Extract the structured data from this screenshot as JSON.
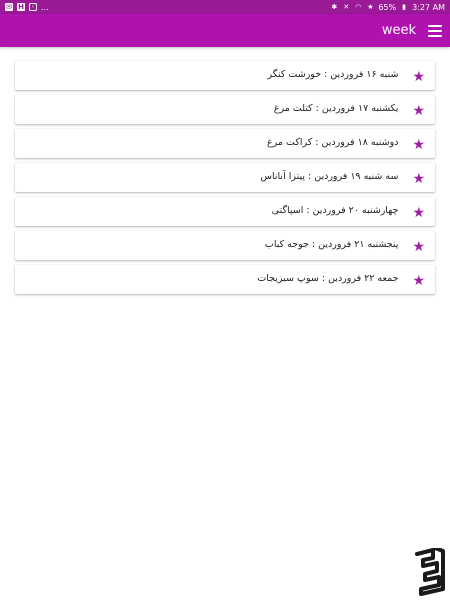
{
  "status_bar": {
    "battery": "65%",
    "time": "3:27 AM",
    "ellipsis": "..."
  },
  "app_bar": {
    "title": "week"
  },
  "days": [
    {
      "text": "شنبه ۱۶ فروردین : خورشت کنگر"
    },
    {
      "text": "یکشنبه ۱۷ فروردین : کتلت مرغ"
    },
    {
      "text": "دوشنبه ۱۸ فروردین : کراکت مرغ"
    },
    {
      "text": "سه شنبه ۱۹ فروردین : پیتزا آناناس"
    },
    {
      "text": "چهارشنبه ۲۰ فروردین : اسپاگتی"
    },
    {
      "text": "پنجشنبه ۲۱ فروردین : جوجه کباب"
    },
    {
      "text": "جمعه ۲۲ فروردین : سوپ سبزیجات"
    }
  ],
  "icons": {
    "item": "star-icon",
    "menu": "hamburger-menu-icon",
    "watermark": "app-store-logo"
  },
  "colors": {
    "status_bar": "#9a1a98",
    "app_bar": "#b012b0",
    "star": "#a21fa5"
  }
}
